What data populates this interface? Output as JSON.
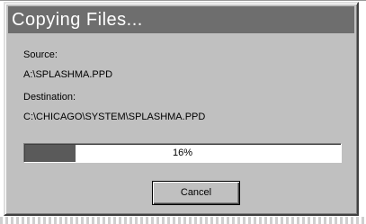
{
  "dialog": {
    "title": "Copying Files...",
    "source_label": "Source:",
    "source_value": "A:\\SPLASHMA.PPD",
    "destination_label": "Destination:",
    "destination_value": "C:\\CHICAGO\\SYSTEM\\SPLASHMA.PPD",
    "progress": {
      "percent": 16,
      "text": "16%"
    },
    "cancel_label": "Cancel"
  },
  "colors": {
    "title_bar": "#6e6e6e",
    "dialog_face": "#c0c0c0",
    "progress_fill": "#5a5a5a"
  }
}
